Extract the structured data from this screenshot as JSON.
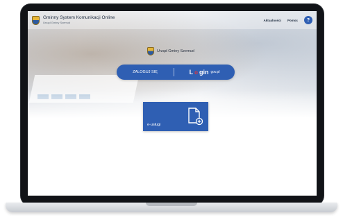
{
  "header": {
    "app_title": "Gminny System Komunikacji Online",
    "app_subtitle": "Urząd Gminy Szemud",
    "links": [
      "Aktualności",
      "Pomoc"
    ],
    "help_label": "?"
  },
  "office": {
    "name": "Urząd Gminy Szemud"
  },
  "login": {
    "button_label": "ZALOGUJ SIĘ",
    "provider_prefix": "L",
    "provider_mid": "o",
    "provider_suffix": "gin",
    "provider_domain": "gov.pl"
  },
  "services": {
    "tile_label": "e-usługi"
  },
  "colors": {
    "brand_blue": "#2f5fb3",
    "login_gov_red": "#e0353c"
  },
  "icons": [
    "crest-icon",
    "help-icon",
    "document-add-icon"
  ]
}
